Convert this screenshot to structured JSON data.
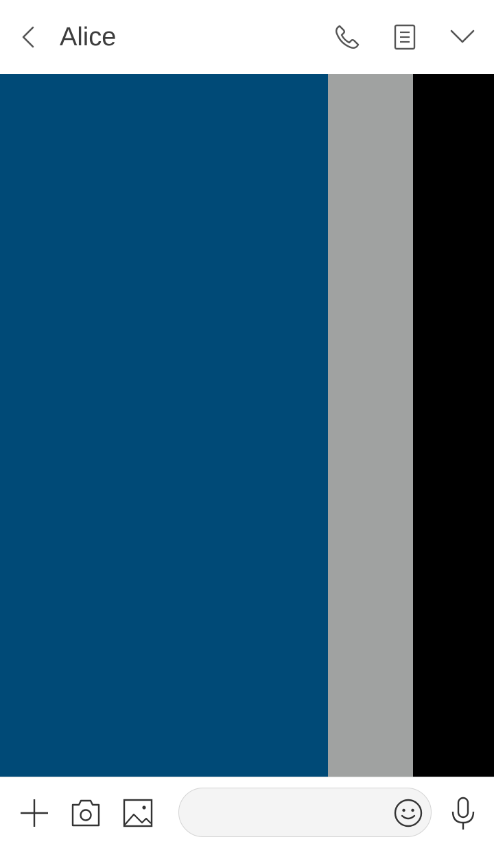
{
  "header": {
    "title": "Alice",
    "back_icon": "chevron-left-icon",
    "actions": [
      {
        "name": "call-button",
        "icon": "phone-icon"
      },
      {
        "name": "notes-button",
        "icon": "document-icon"
      },
      {
        "name": "expand-button",
        "icon": "chevron-down-icon"
      }
    ]
  },
  "wallpaper": {
    "stripes": [
      {
        "color": "#004a77"
      },
      {
        "color": "#a0a2a1"
      },
      {
        "color": "#000000"
      }
    ]
  },
  "input_bar": {
    "message_value": "",
    "message_placeholder": "",
    "buttons": [
      {
        "name": "plus-button",
        "icon": "plus-icon"
      },
      {
        "name": "camera-button",
        "icon": "camera-icon"
      },
      {
        "name": "gallery-button",
        "icon": "image-icon"
      },
      {
        "name": "emoji-button",
        "icon": "smiley-icon"
      },
      {
        "name": "voice-button",
        "icon": "microphone-icon"
      }
    ]
  },
  "colors": {
    "icon": "#555555",
    "title": "#3d3d3d",
    "input_fill": "#f4f4f4",
    "input_border": "#d4d4d4"
  }
}
